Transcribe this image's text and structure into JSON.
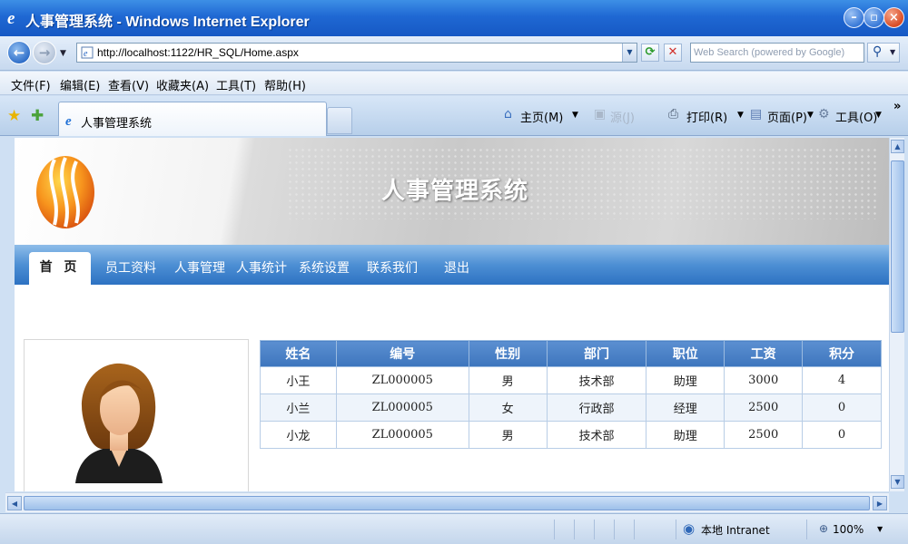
{
  "window": {
    "title": "人事管理系统 - Windows Internet Explorer"
  },
  "addressbar": {
    "url": "http://localhost:1122/HR_SQL/Home.aspx",
    "search_placeholder": "Web Search (powered by Google)"
  },
  "menu": {
    "items": [
      "文件(F)",
      "编辑(E)",
      "查看(V)",
      "收藏夹(A)",
      "工具(T)",
      "帮助(H)"
    ]
  },
  "tabbar": {
    "tab_title": "人事管理系统",
    "commands": {
      "home": "主页(M)",
      "feeds": "源(J)",
      "print": "打印(R)",
      "page": "页面(P)",
      "tools": "工具(O)"
    }
  },
  "page": {
    "system_title": "人事管理系统",
    "nav": [
      "首 页",
      "员工资料",
      "人事管理",
      "人事统计",
      "系统设置",
      "联系我们",
      "退出"
    ],
    "table": {
      "headers": [
        "姓名",
        "编号",
        "性别",
        "部门",
        "职位",
        "工资",
        "积分"
      ],
      "rows": [
        [
          "小王",
          "ZL000005",
          "男",
          "技术部",
          "助理",
          "3000",
          "4"
        ],
        [
          "小兰",
          "ZL000005",
          "女",
          "行政部",
          "经理",
          "2500",
          "0"
        ],
        [
          "小龙",
          "ZL000005",
          "男",
          "技术部",
          "助理",
          "2500",
          "0"
        ]
      ]
    }
  },
  "statusbar": {
    "zone": "本地 Intranet",
    "zoom": "100%"
  },
  "colors": {
    "titlebar": "#1f68d3",
    "nav_blue": "#4d8fd4",
    "table_header": "#4a82c8"
  }
}
